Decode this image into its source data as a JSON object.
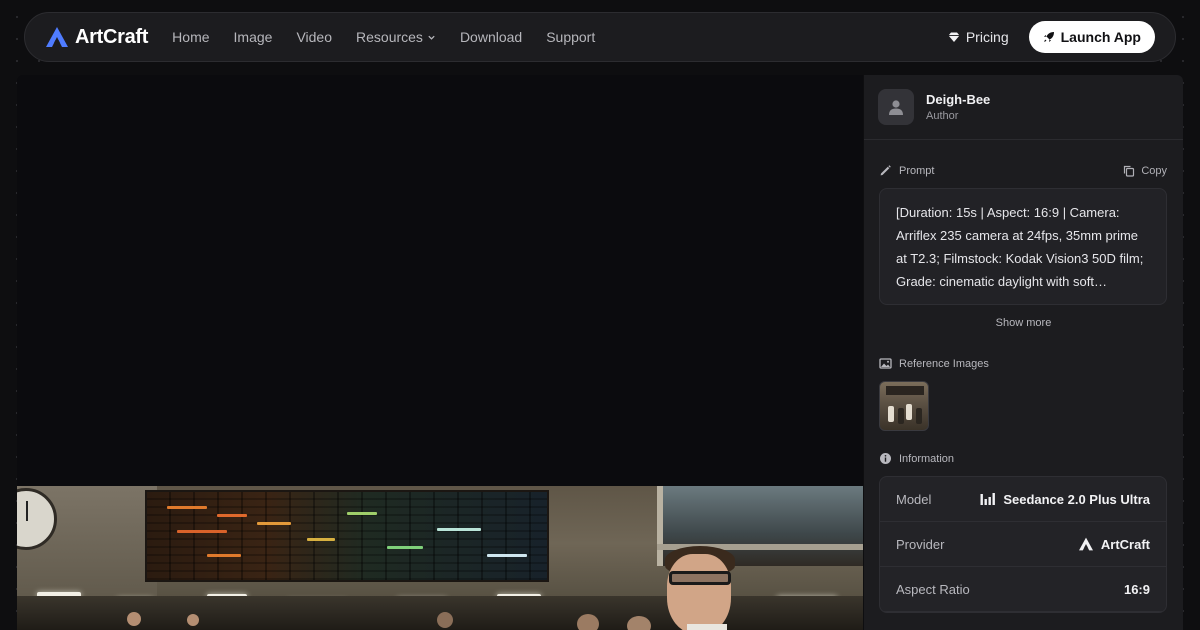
{
  "brand": {
    "name": "ArtCraft"
  },
  "nav": {
    "links": [
      "Home",
      "Image",
      "Video",
      "Resources",
      "Download",
      "Support"
    ],
    "pricing_label": "Pricing",
    "launch_label": "Launch App"
  },
  "author": {
    "name": "Deigh-Bee",
    "role": "Author"
  },
  "prompt": {
    "label": "Prompt",
    "copy_label": "Copy",
    "text": "[Duration: 15s | Aspect: 16:9 | Camera: Arriflex 235 camera at 24fps, 35mm prime at T2.3; Filmstock: Kodak Vision3 50D film; Grade: cinematic daylight with soft…",
    "show_more_label": "Show more"
  },
  "reference": {
    "label": "Reference Images"
  },
  "information": {
    "label": "Information",
    "rows": [
      {
        "key": "Model",
        "value": "Seedance 2.0 Plus Ultra",
        "icon": "bars-logo-icon"
      },
      {
        "key": "Provider",
        "value": "ArtCraft",
        "icon": "artcraft-logo-icon"
      },
      {
        "key": "Aspect Ratio",
        "value": "16:9"
      }
    ]
  },
  "colors": {
    "background": "#0e0e10",
    "panel": "#1c1c1f",
    "accent": "#4f7cff",
    "button_bg": "#ffffff"
  }
}
